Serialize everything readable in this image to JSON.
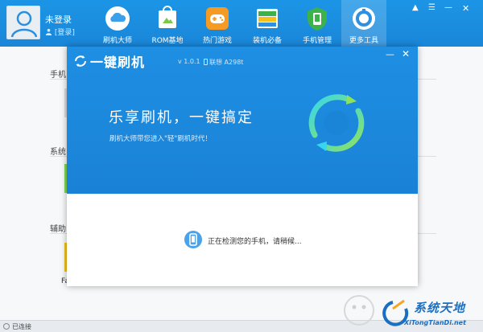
{
  "user": {
    "name": "未登录",
    "login_label": "[登录]"
  },
  "nav": [
    {
      "label": "刷机大师",
      "icon": "cloud-icon"
    },
    {
      "label": "ROM基地",
      "icon": "rom-shop-icon"
    },
    {
      "label": "热门游戏",
      "icon": "gamepad-icon"
    },
    {
      "label": "装机必备",
      "icon": "apps-icon"
    },
    {
      "label": "手机管理",
      "icon": "shield-icon"
    },
    {
      "label": "更多工具",
      "icon": "tools-icon"
    }
  ],
  "sections": [
    "手机",
    "系统",
    "辅助"
  ],
  "fa_label": "Fa",
  "status": "已连接",
  "dialog": {
    "brand": "一键刷机",
    "version": "v 1.0.1",
    "device": "联想 A298t",
    "headline": "乐享刷机，一键搞定",
    "subline": "刷机大师带您进入\"轻\"刷机时代！",
    "detecting": "正在检测您的手机，请稍候..."
  },
  "watermark": {
    "name": "系统天地",
    "url": "XiTongTianDi.net"
  },
  "colors": {
    "primary": "#1a86d8",
    "accent_green": "#7ed957",
    "accent_cyan": "#35d6f0"
  }
}
